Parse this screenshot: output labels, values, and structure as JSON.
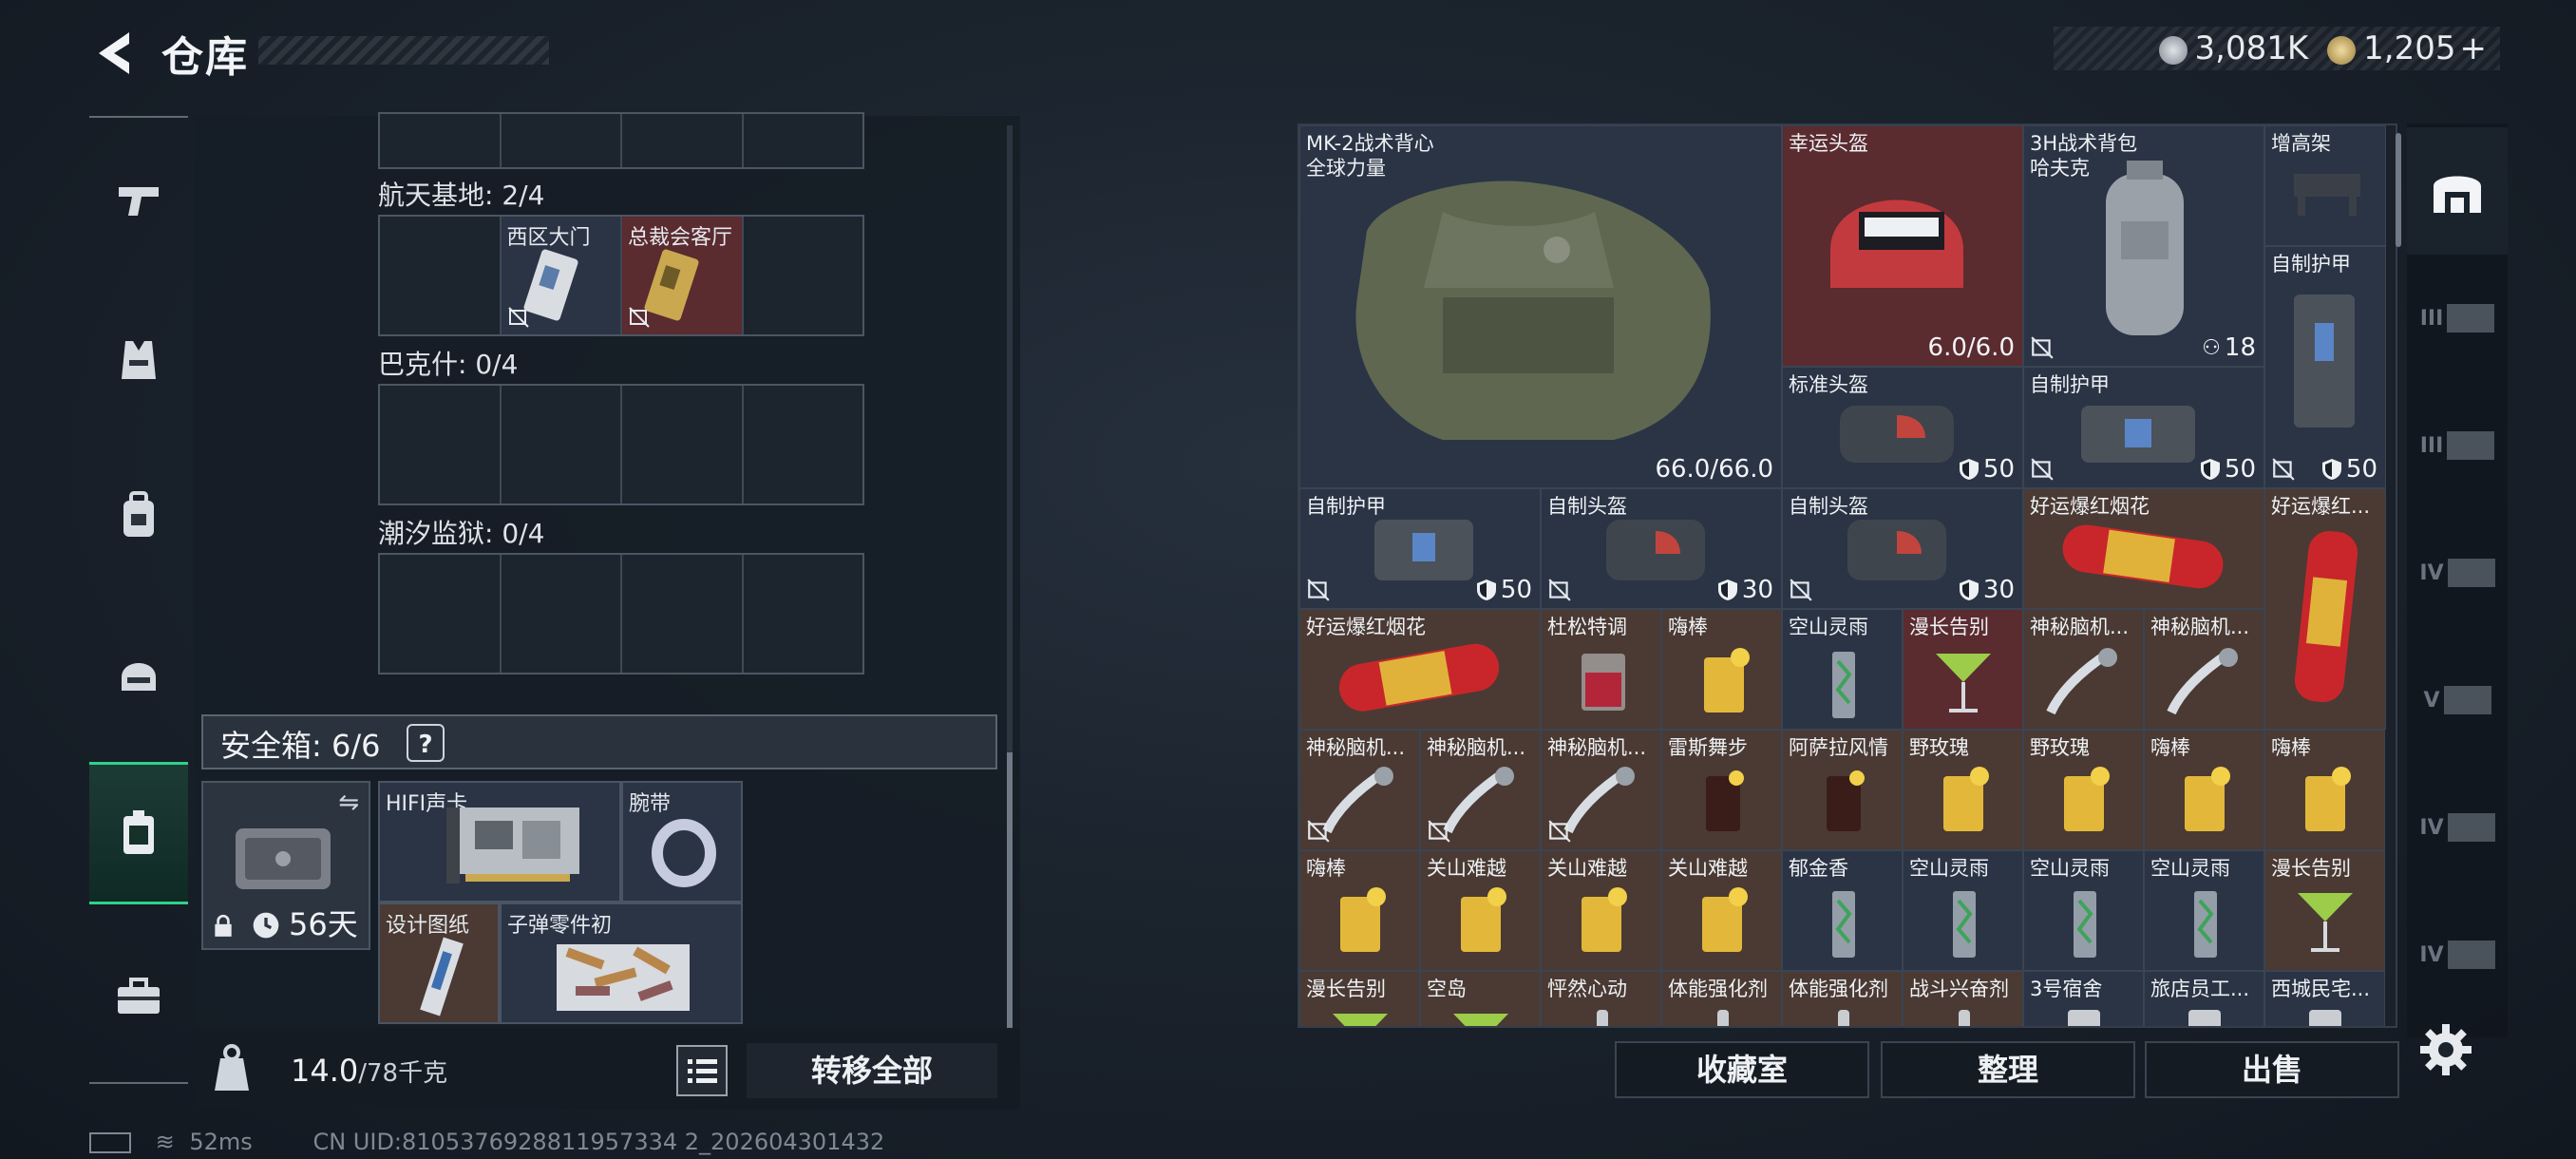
{
  "header": {
    "title": "仓库",
    "currency": [
      {
        "value": "3,081K",
        "color": "#9aa3ad"
      },
      {
        "value": "1,205",
        "plus": "+",
        "color": "#c9b07a"
      }
    ]
  },
  "left_nav": [
    "pistol-icon",
    "armor-vest-icon",
    "backpack-icon",
    "helmet-icon",
    "safe-case-icon",
    "toolbox-icon"
  ],
  "key_sections": [
    {
      "label": "航天基地: 2/4",
      "items": [
        {
          "slot": 1,
          "name": "西区大门",
          "color": "#2a3445"
        },
        {
          "slot": 2,
          "name": "总裁会客厅",
          "color": "#5a2b2f"
        }
      ]
    },
    {
      "label": "巴克什: 0/4",
      "items": []
    },
    {
      "label": "潮汐监狱: 0/4",
      "items": []
    }
  ],
  "safe_box": {
    "title": "安全箱: 6/6",
    "help": "?",
    "timer": "56天",
    "items": [
      {
        "name": "HIFI声卡"
      },
      {
        "name": "腕带"
      },
      {
        "name": "设计图纸"
      },
      {
        "name": "子弹零件初"
      }
    ]
  },
  "bottom_left": {
    "weight": "14.0",
    "weight_unit": "/78千克",
    "transfer_all": "转移全部"
  },
  "status_bar": {
    "ping": "52ms",
    "uid": "CN UID:8105376928811957334 2_202604301432"
  },
  "inventory": {
    "big": [
      {
        "name": "MK-2战术背心",
        "name2": "全球力量",
        "value": "66.0/66.0",
        "bg": "#2a3445"
      },
      {
        "name": "幸运头盔",
        "value": "6.0/6.0",
        "bg": "#5a2b2f"
      },
      {
        "name": "3H战术背包",
        "name2": "哈夫克",
        "value": "18",
        "bg": "#2a3445"
      },
      {
        "name": "增高架",
        "bg": "#2a3445"
      },
      {
        "name": "自制护甲",
        "value": "50",
        "bg": "#2a3445"
      },
      {
        "name": "标准头盔",
        "value": "50",
        "bg": "#2a3445"
      },
      {
        "name": "自制护甲",
        "value": "50",
        "bg": "#2a3445"
      }
    ],
    "row3": [
      {
        "name": "自制护甲",
        "value": "50"
      },
      {
        "name": "自制头盔",
        "value": "30"
      },
      {
        "name": "自制头盔",
        "value": "30"
      },
      {
        "name": "好运爆红烟花"
      },
      {
        "name": "好运爆红..."
      }
    ],
    "row4": [
      {
        "name": "好运爆红烟花",
        "bg": "#4a3a33"
      },
      {
        "name": "杜松特调",
        "bg": "#4a3a33"
      },
      {
        "name": "嗨棒",
        "bg": "#4a3a33"
      },
      {
        "name": "空山灵雨",
        "bg": "#2a3445"
      },
      {
        "name": "漫长告别",
        "bg": "#5a2b2f"
      },
      {
        "name": "神秘脑机...",
        "bg": "#4a3a33"
      },
      {
        "name": "神秘脑机...",
        "bg": "#4a3a33"
      }
    ],
    "row5": [
      {
        "name": "神秘脑机...",
        "bg": "#4a3a33"
      },
      {
        "name": "神秘脑机...",
        "bg": "#4a3a33"
      },
      {
        "name": "神秘脑机...",
        "bg": "#4a3a33"
      },
      {
        "name": "雷斯舞步",
        "bg": "#4a3a33"
      },
      {
        "name": "阿萨拉风情",
        "bg": "#4a3a33"
      },
      {
        "name": "野玫瑰",
        "bg": "#4a3a33"
      },
      {
        "name": "野玫瑰",
        "bg": "#4a3a33"
      },
      {
        "name": "嗨棒",
        "bg": "#4a3a33"
      },
      {
        "name": "嗨棒",
        "bg": "#4a3a33"
      }
    ],
    "row6": [
      {
        "name": "嗨棒",
        "bg": "#4a3a33"
      },
      {
        "name": "关山难越",
        "bg": "#4a3a33"
      },
      {
        "name": "关山难越",
        "bg": "#4a3a33"
      },
      {
        "name": "关山难越",
        "bg": "#4a3a33"
      },
      {
        "name": "郁金香",
        "bg": "#2a3445"
      },
      {
        "name": "空山灵雨",
        "bg": "#2a3445"
      },
      {
        "name": "空山灵雨",
        "bg": "#2a3445"
      },
      {
        "name": "空山灵雨",
        "bg": "#2a3445"
      },
      {
        "name": "漫长告别",
        "bg": "#4a3a33"
      }
    ],
    "row7": [
      {
        "name": "漫长告别",
        "bg": "#4a3a33"
      },
      {
        "name": "空岛",
        "bg": "#4a3a33"
      },
      {
        "name": "怦然心动",
        "bg": "#4a3a33"
      },
      {
        "name": "体能强化剂",
        "bg": "#4a3a33"
      },
      {
        "name": "体能强化剂",
        "bg": "#4a3a33"
      },
      {
        "name": "战斗兴奋剂",
        "bg": "#4a3a33"
      },
      {
        "name": "3号宿舍",
        "bg": "#2a3445"
      },
      {
        "name": "旅店员工...",
        "bg": "#2a3445"
      },
      {
        "name": "西城民宅...",
        "bg": "#2a3445"
      }
    ]
  },
  "right_tabs": [
    "inventory-arch-icon",
    "III",
    "III",
    "IV",
    "V",
    "IV",
    "IV"
  ],
  "bottom_right": {
    "collection": "收藏室",
    "sort": "整理",
    "sell": "出售"
  }
}
